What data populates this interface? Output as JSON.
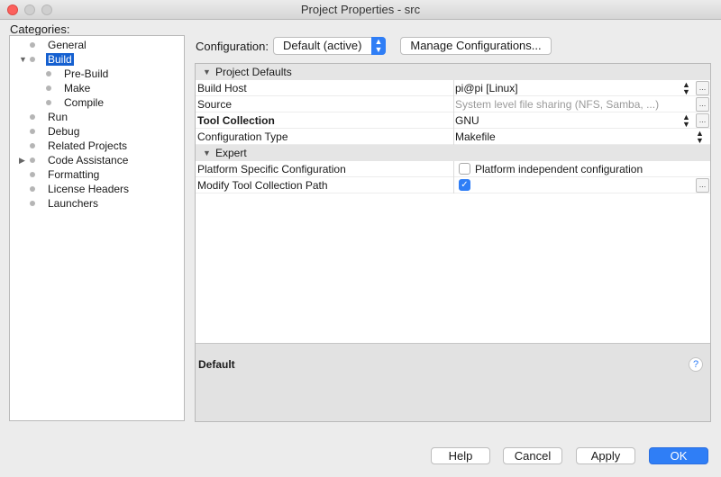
{
  "window": {
    "title": "Project Properties - src"
  },
  "categories": {
    "label": "Categories:",
    "items": [
      {
        "label": "General",
        "expander": ""
      },
      {
        "label": "Build",
        "expander": "▼"
      },
      {
        "label": "Pre-Build",
        "expander": ""
      },
      {
        "label": "Make",
        "expander": ""
      },
      {
        "label": "Compile",
        "expander": ""
      },
      {
        "label": "Run",
        "expander": ""
      },
      {
        "label": "Debug",
        "expander": ""
      },
      {
        "label": "Related Projects",
        "expander": ""
      },
      {
        "label": "Code Assistance",
        "expander": "▶"
      },
      {
        "label": "Formatting",
        "expander": ""
      },
      {
        "label": "License Headers",
        "expander": ""
      },
      {
        "label": "Launchers",
        "expander": ""
      }
    ],
    "selected": "Build"
  },
  "configuration": {
    "label": "Configuration:",
    "selected": "Default (active)",
    "manage_label": "Manage Configurations..."
  },
  "properties": {
    "project_defaults": {
      "title": "Project Defaults",
      "rows": [
        {
          "name": "Build Host",
          "value": "pi@pi [Linux]"
        },
        {
          "name": "Source",
          "value": "System level file sharing (NFS, Samba, ...)"
        },
        {
          "name": "Tool Collection",
          "value": "GNU"
        },
        {
          "name": "Configuration Type",
          "value": "Makefile"
        }
      ]
    },
    "expert": {
      "title": "Expert",
      "rows": [
        {
          "name": "Platform Specific Configuration",
          "value": "Platform independent configuration",
          "checked": false
        },
        {
          "name": "Modify Tool Collection Path",
          "value": "",
          "checked": true
        }
      ]
    },
    "dots_label": "..."
  },
  "description": {
    "title": "Default",
    "help_glyph": "?"
  },
  "buttons": {
    "help": "Help",
    "cancel": "Cancel",
    "apply": "Apply",
    "ok": "OK"
  },
  "colors": {
    "accent": "#2f7ef6",
    "selection": "#1560d0"
  }
}
